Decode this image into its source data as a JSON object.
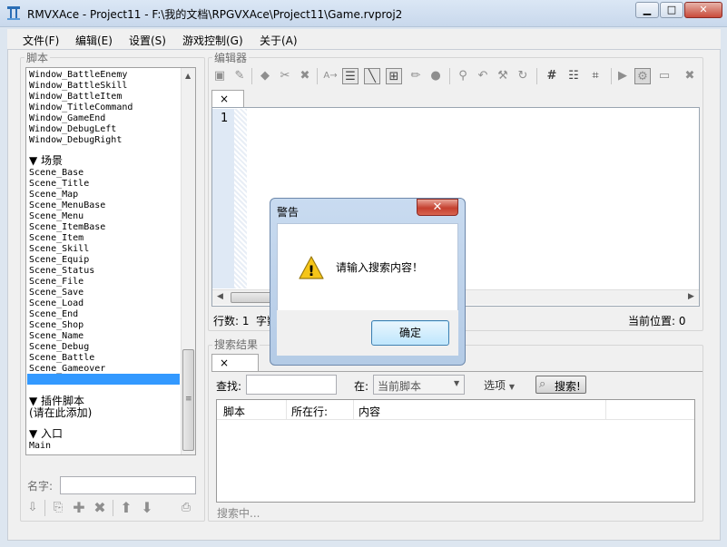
{
  "window": {
    "title": "RMVXAce - Project11 - F:\\我的文档\\RPGVXAce\\Project11\\Game.rvproj2",
    "minimize_glyph": "▁",
    "maximize_glyph": "□",
    "close_glyph": "✕"
  },
  "menu": [
    "文件(F)",
    "编辑(E)",
    "设置(S)",
    "游戏控制(G)",
    "关于(A)"
  ],
  "script_panel": {
    "label": "脚本",
    "top_items": [
      "Window_BattleEnemy",
      "Window_BattleSkill",
      "Window_BattleItem",
      "Window_TitleCommand",
      "Window_GameEnd",
      "Window_DebugLeft",
      "Window_DebugRight"
    ],
    "scene_section": "▼ 场景",
    "scene_items": [
      "Scene_Base",
      "Scene_Title",
      "Scene_Map",
      "Scene_MenuBase",
      "Scene_Menu",
      "Scene_ItemBase",
      "Scene_Item",
      "Scene_Skill",
      "Scene_Equip",
      "Scene_Status",
      "Scene_File",
      "Scene_Save",
      "Scene_Load",
      "Scene_End",
      "Scene_Shop",
      "Scene_Name",
      "Scene_Debug",
      "Scene_Battle",
      "Scene_Gameover"
    ],
    "plugin_section": "▼ 插件脚本",
    "plugin_hint": "(请在此添加)",
    "entry_section": "▼ 入口",
    "entry_items": [
      "Main"
    ],
    "name_label": "名字:"
  },
  "editor": {
    "label": "编辑器",
    "tab_close": "×",
    "line_number": "1",
    "status_lines": "行数: 1",
    "status_chars": "字数",
    "status_position": "当前位置: 0"
  },
  "search": {
    "label": "搜索结果",
    "tab_close": "×",
    "find_label": "查找:",
    "find_value": "",
    "in_label": "在:",
    "scope_value": "当前脚本",
    "options_label": "选项",
    "search_button": "搜索!",
    "columns": [
      "脚本",
      "所在行:",
      "内容"
    ],
    "status": "搜索中..."
  },
  "dialog": {
    "title": "警告",
    "message": "请输入搜索内容！",
    "ok_label": "确定",
    "close_glyph": "✕",
    "warning_glyph": "!"
  }
}
